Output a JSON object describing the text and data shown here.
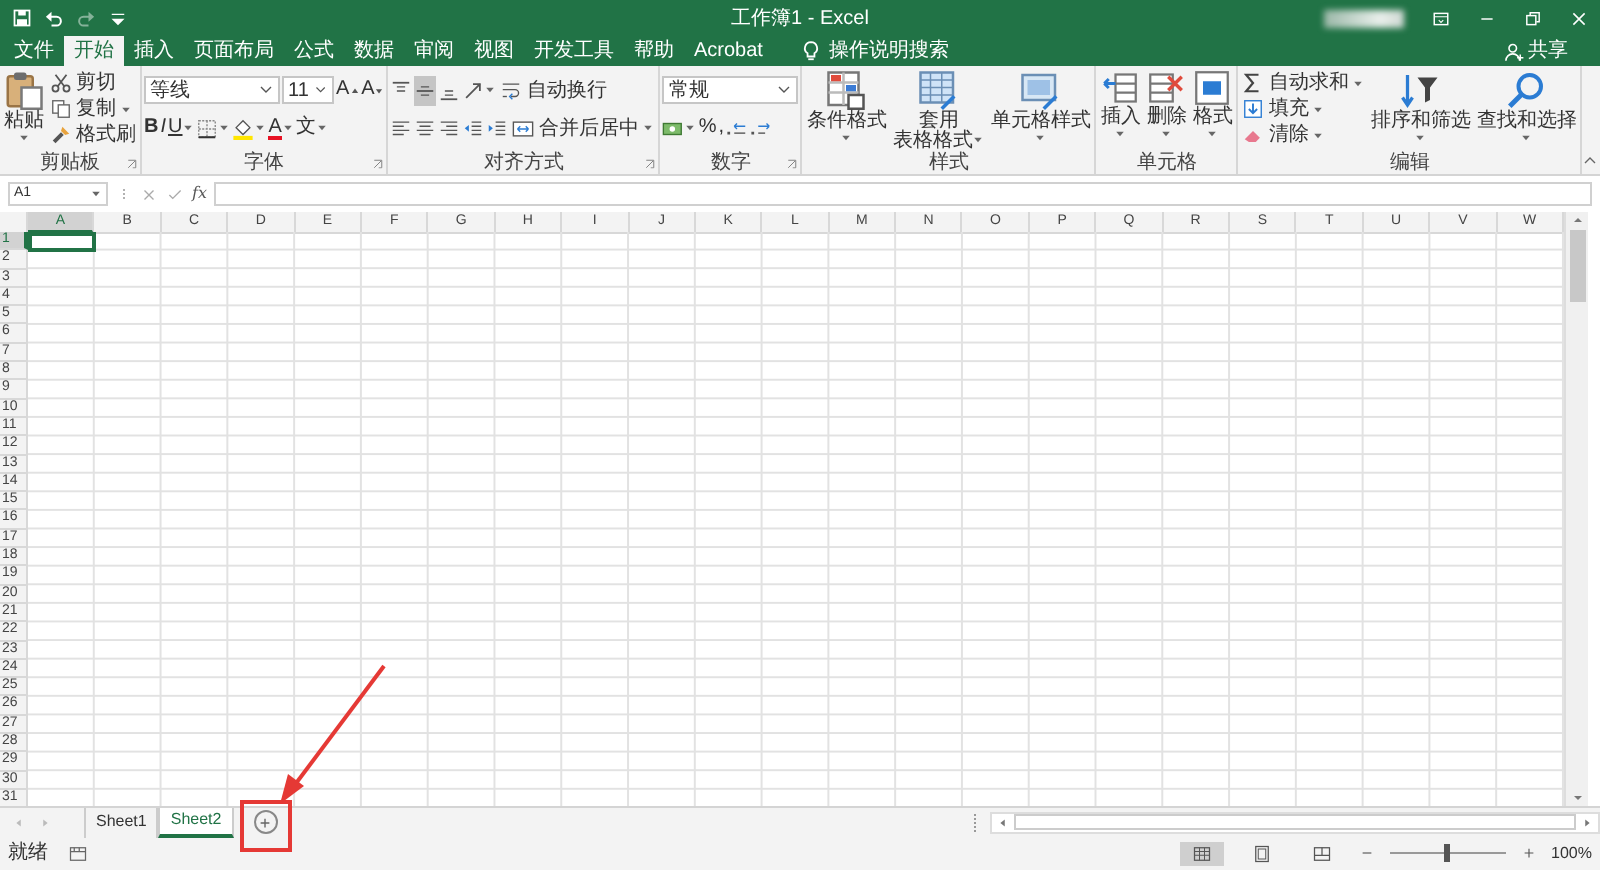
{
  "title_bar": {
    "quick_access": [
      {
        "kind": "save",
        "disabled": false
      },
      {
        "kind": "undo",
        "disabled": false
      },
      {
        "kind": "redo",
        "disabled": true
      },
      {
        "kind": "customize",
        "disabled": false
      }
    ],
    "title": "工作簿1 - Excel"
  },
  "tabs": [
    {
      "label": "文件",
      "selected": false
    },
    {
      "label": "开始",
      "selected": true
    },
    {
      "label": "插入",
      "selected": false
    },
    {
      "label": "页面布局",
      "selected": false
    },
    {
      "label": "公式",
      "selected": false
    },
    {
      "label": "数据",
      "selected": false
    },
    {
      "label": "审阅",
      "selected": false
    },
    {
      "label": "视图",
      "selected": false
    },
    {
      "label": "开发工具",
      "selected": false
    },
    {
      "label": "帮助",
      "selected": false
    },
    {
      "label": "Acrobat",
      "selected": false
    }
  ],
  "tell_me": {
    "label": "操作说明搜索"
  },
  "share": {
    "label": "共享"
  },
  "ribbon": [
    {
      "label": "剪贴板",
      "launcher": true,
      "items": [
        {
          "kind": "large",
          "lines": [
            "粘贴"
          ],
          "dropdown": true
        },
        {
          "kind": "stack",
          "items": [
            {
              "label": "剪切",
              "dropdown": false
            },
            {
              "label": "复制",
              "dropdown": true
            },
            {
              "label": "格式刷",
              "dropdown": false
            }
          ]
        }
      ]
    },
    {
      "label": "字体",
      "launcher": true,
      "items": [
        {
          "kind": "tiers",
          "tiers": [
            {
              "controls": [
                {
                  "kind": "combo",
                  "value": "等线"
                },
                {
                  "kind": "combo",
                  "value": "11"
                },
                {
                  "kind": "grow",
                  "text": "A"
                },
                {
                  "kind": "shrink",
                  "text": "A"
                }
              ]
            },
            {
              "controls": [
                {
                  "kind": "bold",
                  "text": "B",
                  "dropdown": false
                },
                {
                  "kind": "italic",
                  "text": "I",
                  "dropdown": false
                },
                {
                  "kind": "underline",
                  "text": "U",
                  "dropdown": true
                },
                {
                  "kind": "icon",
                  "dropdown": true,
                  "selected": false
                },
                {
                  "kind": "icon",
                  "dropdown": true,
                  "selected": false
                },
                {
                  "kind": "color",
                  "text": "A",
                  "dropdown": true
                },
                {
                  "kind": "glyph",
                  "text": "文",
                  "dropdown": true
                }
              ]
            }
          ]
        }
      ]
    },
    {
      "label": "对齐方式",
      "launcher": true,
      "items": [
        {
          "kind": "tiers",
          "tiers": [
            {
              "controls": [
                {
                  "kind": "icon",
                  "dropdown": false,
                  "selected": false
                },
                {
                  "kind": "icon",
                  "dropdown": false,
                  "selected": true
                },
                {
                  "kind": "icon",
                  "dropdown": false,
                  "selected": false
                },
                {
                  "kind": "icon",
                  "dropdown": true,
                  "selected": false
                },
                {
                  "kind": "iconlabel",
                  "label": "自动换行",
                  "dropdown": false
                }
              ]
            },
            {
              "controls": [
                {
                  "kind": "icon",
                  "dropdown": false,
                  "selected": false
                },
                {
                  "kind": "icon",
                  "dropdown": false,
                  "selected": false
                },
                {
                  "kind": "icon",
                  "dropdown": false,
                  "selected": false
                },
                {
                  "kind": "icon",
                  "dropdown": false,
                  "selected": false
                },
                {
                  "kind": "icon",
                  "dropdown": false,
                  "selected": false
                },
                {
                  "kind": "iconlabel",
                  "label": "合并后居中",
                  "dropdown": true
                }
              ]
            }
          ]
        }
      ]
    },
    {
      "label": "数字",
      "launcher": true,
      "items": [
        {
          "kind": "tiers",
          "tiers": [
            {
              "controls": [
                {
                  "kind": "combo",
                  "value": "常规"
                }
              ]
            },
            {
              "controls": [
                {
                  "kind": "icon",
                  "dropdown": true,
                  "selected": false
                },
                {
                  "kind": "glyph",
                  "text": "%",
                  "dropdown": false
                },
                {
                  "kind": "glyph",
                  "text": ",",
                  "dropdown": false
                },
                {
                  "kind": "icon",
                  "dropdown": false,
                  "selected": false
                },
                {
                  "kind": "icon",
                  "dropdown": false,
                  "selected": false
                }
              ]
            }
          ]
        }
      ]
    },
    {
      "label": "样式",
      "launcher": false,
      "items": [
        {
          "kind": "large",
          "lines": [
            "条件格式"
          ],
          "dropdown": true
        },
        {
          "kind": "large",
          "lines": [
            "套用",
            "表格格式"
          ],
          "dropdown": true
        },
        {
          "kind": "large",
          "lines": [
            "单元格样式"
          ],
          "dropdown": true
        }
      ]
    },
    {
      "label": "单元格",
      "launcher": false,
      "items": [
        {
          "kind": "large",
          "lines": [
            "插入"
          ],
          "dropdown": true
        },
        {
          "kind": "large",
          "lines": [
            "删除"
          ],
          "dropdown": true
        },
        {
          "kind": "large",
          "lines": [
            "格式"
          ],
          "dropdown": true
        }
      ]
    },
    {
      "label": "编辑",
      "launcher": false,
      "items": [
        {
          "kind": "stack",
          "items": [
            {
              "label": "自动求和",
              "dropdown": true
            },
            {
              "label": "填充",
              "dropdown": true
            },
            {
              "label": "清除",
              "dropdown": true
            }
          ]
        },
        {
          "kind": "large",
          "lines": [
            "排序和筛选"
          ],
          "dropdown": true
        },
        {
          "kind": "large",
          "lines": [
            "查找和选择"
          ],
          "dropdown": true
        }
      ]
    }
  ],
  "formula_bar": {
    "name_box": "A1",
    "function_label": "fx"
  },
  "grid": {
    "columns": [
      {
        "label": "A",
        "selected": true
      },
      {
        "label": "B",
        "selected": false
      },
      {
        "label": "C",
        "selected": false
      },
      {
        "label": "D",
        "selected": false
      },
      {
        "label": "E",
        "selected": false
      },
      {
        "label": "F",
        "selected": false
      },
      {
        "label": "G",
        "selected": false
      },
      {
        "label": "H",
        "selected": false
      },
      {
        "label": "I",
        "selected": false
      },
      {
        "label": "J",
        "selected": false
      },
      {
        "label": "K",
        "selected": false
      },
      {
        "label": "L",
        "selected": false
      },
      {
        "label": "M",
        "selected": false
      },
      {
        "label": "N",
        "selected": false
      },
      {
        "label": "O",
        "selected": false
      },
      {
        "label": "P",
        "selected": false
      },
      {
        "label": "Q",
        "selected": false
      },
      {
        "label": "R",
        "selected": false
      },
      {
        "label": "S",
        "selected": false
      },
      {
        "label": "T",
        "selected": false
      },
      {
        "label": "U",
        "selected": false
      },
      {
        "label": "V",
        "selected": false
      },
      {
        "label": "W",
        "selected": false
      }
    ],
    "rows": [
      {
        "label": "1",
        "selected": true
      },
      {
        "label": "2",
        "selected": false
      },
      {
        "label": "3",
        "selected": false
      },
      {
        "label": "4",
        "selected": false
      },
      {
        "label": "5",
        "selected": false
      },
      {
        "label": "6",
        "selected": false
      },
      {
        "label": "7",
        "selected": false
      },
      {
        "label": "8",
        "selected": false
      },
      {
        "label": "9",
        "selected": false
      },
      {
        "label": "10",
        "selected": false
      },
      {
        "label": "11",
        "selected": false
      },
      {
        "label": "12",
        "selected": false
      },
      {
        "label": "13",
        "selected": false
      },
      {
        "label": "14",
        "selected": false
      },
      {
        "label": "15",
        "selected": false
      },
      {
        "label": "16",
        "selected": false
      },
      {
        "label": "17",
        "selected": false
      },
      {
        "label": "18",
        "selected": false
      },
      {
        "label": "19",
        "selected": false
      },
      {
        "label": "20",
        "selected": false
      },
      {
        "label": "21",
        "selected": false
      },
      {
        "label": "22",
        "selected": false
      },
      {
        "label": "23",
        "selected": false
      },
      {
        "label": "24",
        "selected": false
      },
      {
        "label": "25",
        "selected": false
      },
      {
        "label": "26",
        "selected": false
      },
      {
        "label": "27",
        "selected": false
      },
      {
        "label": "28",
        "selected": false
      },
      {
        "label": "29",
        "selected": false
      },
      {
        "label": "30",
        "selected": false
      },
      {
        "label": "31",
        "selected": false
      }
    ]
  },
  "sheets": [
    {
      "label": "Sheet1",
      "selected": false
    },
    {
      "label": "Sheet2",
      "selected": true
    }
  ],
  "status_bar": {
    "text": "就绪",
    "views": [
      {
        "selected": true
      },
      {
        "selected": false
      },
      {
        "selected": false
      }
    ],
    "zoom": {
      "level": 0.5,
      "reading": "100%"
    }
  }
}
